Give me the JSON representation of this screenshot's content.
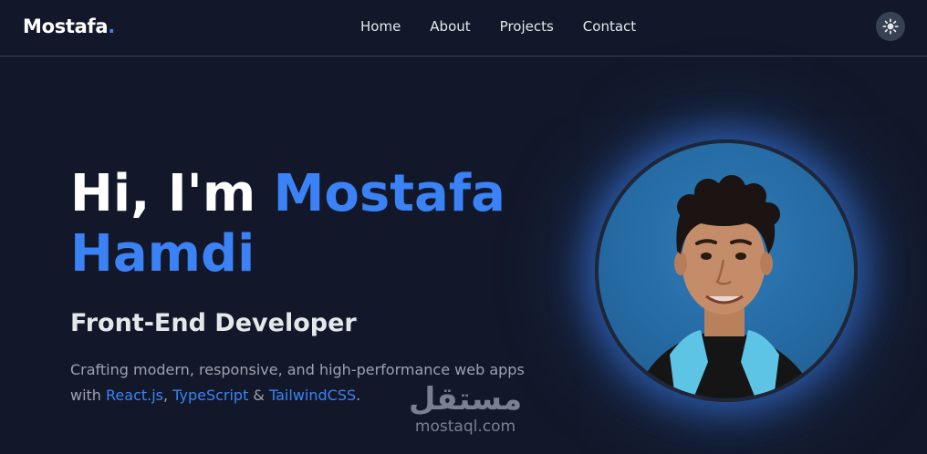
{
  "nav": {
    "logo": "Mostafa",
    "logo_dot": ".",
    "links": [
      "Home",
      "About",
      "Projects",
      "Contact"
    ]
  },
  "hero": {
    "greeting": "Hi, I'm ",
    "first_name": "Mostafa",
    "last_name": "Hamdi",
    "role": "Front-End Developer",
    "desc_prefix": "Crafting modern, responsive, and high-performance web apps with ",
    "tech1": "React.js",
    "sep1": ", ",
    "tech2": "TypeScript",
    "sep2": " & ",
    "tech3": "TailwindCSS",
    "desc_suffix": "."
  },
  "watermark": {
    "arabic": "مستقل",
    "latin": "mostaql.com"
  },
  "icons": {
    "theme_toggle": "sun-icon"
  },
  "colors": {
    "background": "#121829",
    "accent": "#3b82f6",
    "muted_text": "#9ca3af"
  }
}
